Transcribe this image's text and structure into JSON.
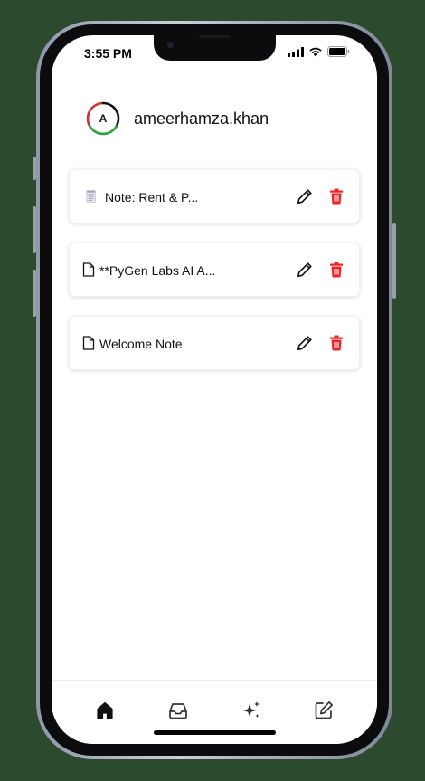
{
  "status_bar": {
    "time": "3:55 PM",
    "icons": [
      "signal-icon",
      "wifi-icon",
      "battery-icon"
    ]
  },
  "header": {
    "avatar_letter": "A",
    "username": "ameerhamza.khan"
  },
  "notes": [
    {
      "title": "Note: Rent & P...",
      "icon": "notepad-icon"
    },
    {
      "title": "**PyGen Labs AI A...",
      "icon": "document-icon"
    },
    {
      "title": "Welcome Note",
      "icon": "document-icon"
    }
  ],
  "note_actions": {
    "edit_icon": "pencil-icon",
    "delete_icon": "trash-icon",
    "delete_color": "#e8262a"
  },
  "bottom_nav": {
    "items": [
      "home-icon",
      "inbox-icon",
      "sparkles-icon",
      "compose-icon"
    ]
  },
  "colors": {
    "background": "#2b4a2e",
    "avatar_ring_red": "#d32f2f",
    "avatar_ring_green": "#2e9e3f"
  }
}
